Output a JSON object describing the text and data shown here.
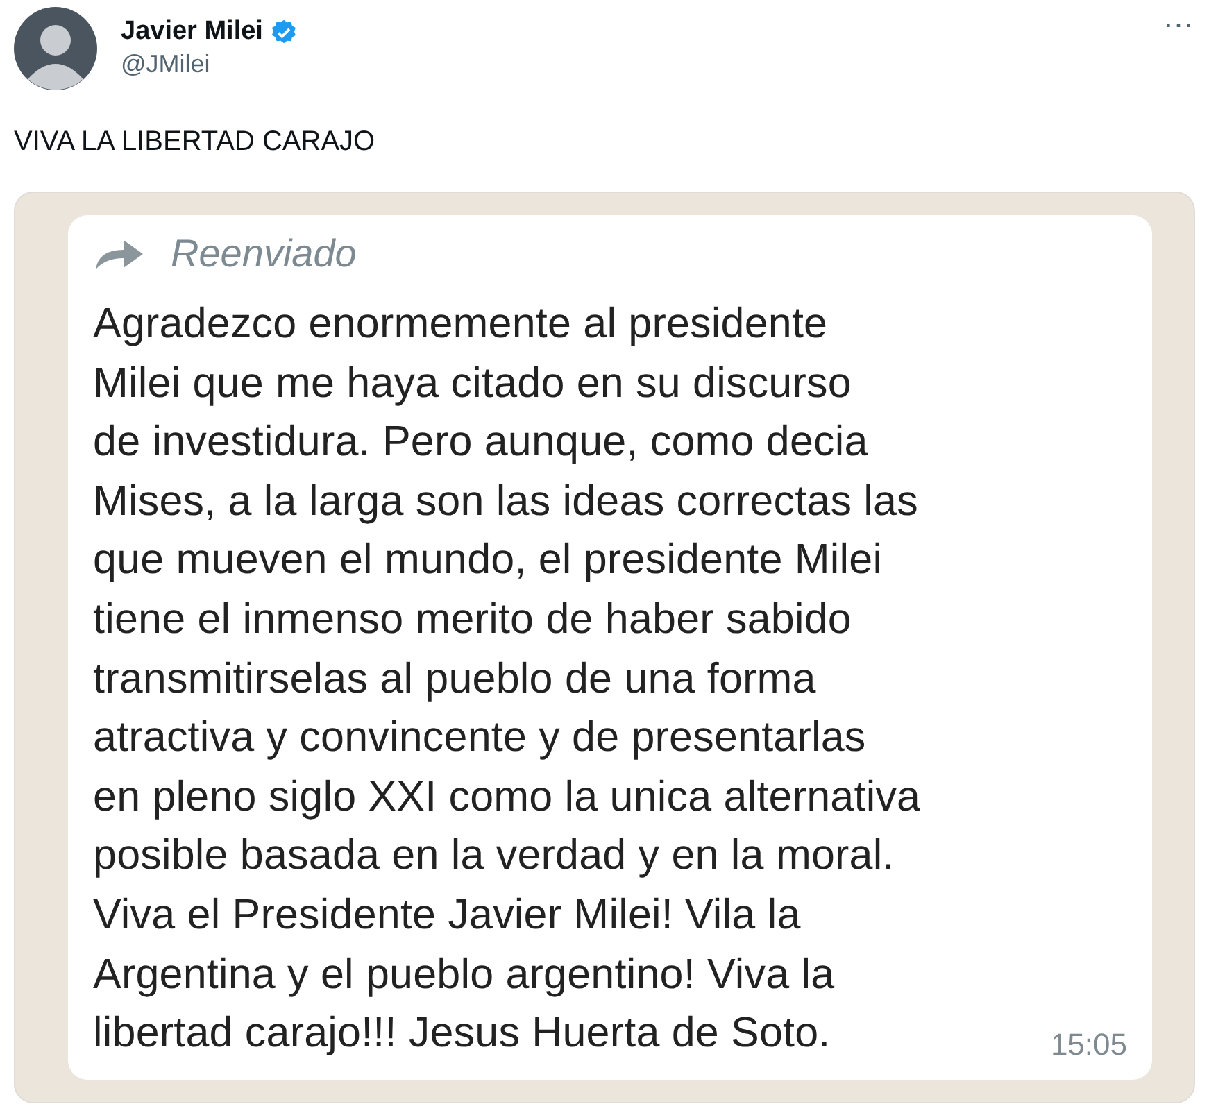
{
  "author": {
    "name": "Javier Milei",
    "verified": true,
    "handle": "@JMilei"
  },
  "more_menu": "⋯",
  "tweet_text": "VIVA LA LIBERTAD CARAJO",
  "attached_screenshot": {
    "forwarded_label": "Reenviado",
    "message": "Agradezco enormemente al presidente\nMilei que me haya citado en su discurso\nde investidura. Pero aunque, como decia\nMises, a la larga son las ideas correctas las\nque mueven el mundo, el presidente Milei\ntiene el inmenso merito de haber sabido\ntransmitirselas al pueblo de una forma\natractiva y convincente y de presentarlas\nen pleno siglo XXI como la unica alternativa\nposible basada en la verdad y en la moral.\nViva el Presidente Javier Milei! Vila la\nArgentina y el pueblo argentino! Viva la\nlibertad carajo!!! Jesus Huerta de Soto.",
    "time": "15:05"
  }
}
